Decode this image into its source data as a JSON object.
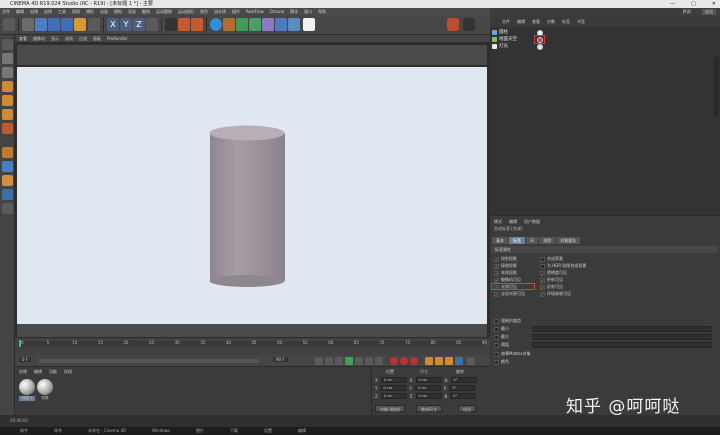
{
  "window": {
    "title": "CINEMA 4D R19.024 Studio (RC - R19) - [未标题 1 *] - 主要",
    "controls": [
      "—",
      "□",
      "✕"
    ]
  },
  "menu": [
    "文件",
    "编辑",
    "创建",
    "选择",
    "工具",
    "网格",
    "捕捉",
    "动画",
    "模拟",
    "渲染",
    "雕刻",
    "运动跟踪",
    "运动图形",
    "角色",
    "流水线",
    "插件",
    "RealFlow",
    "Octane",
    "脚本",
    "窗口",
    "帮助"
  ],
  "right_top": {
    "interface_label": "界面:",
    "interface_value": "启动"
  },
  "viewport": {
    "menu": [
      "查看",
      "摄像机",
      "显示",
      "选项",
      "过滤",
      "面板",
      "ProRender"
    ],
    "label": "透视视图"
  },
  "object_manager": {
    "menu": [
      "文件",
      "编辑",
      "查看",
      "对象",
      "标签",
      "书签"
    ],
    "objects": [
      {
        "name": "圆柱",
        "icon": "cylinder-icon",
        "color": "#6aa2e6"
      },
      {
        "name": "地面天空",
        "icon": "sky-icon",
        "color": "#7fbf6a"
      },
      {
        "name": "灯光",
        "icon": "light-icon",
        "color": "#e8e8e8"
      }
    ]
  },
  "attributes": {
    "menu": [
      "模式",
      "编辑",
      "用户数据"
    ],
    "title": "合成标签 [合成]",
    "tabs": [
      "基本",
      "标签",
      "GI",
      "排除",
      "对象缓存"
    ],
    "active_tab": "标签",
    "section": "标签属性",
    "left_props": [
      {
        "label": "投射投影",
        "checked": true
      },
      {
        "label": "接收投影",
        "checked": true
      },
      {
        "label": "本体投影",
        "checked": true
      },
      {
        "label": "摄像机可见",
        "checked": true,
        "highlight": true
      },
      {
        "label": "光线可见",
        "checked": true
      },
      {
        "label": "全局光照可见",
        "checked": true
      }
    ],
    "right_props": [
      {
        "label": "合成背景",
        "checked": false
      },
      {
        "label": "为 HDR 贴图合成背景",
        "checked": false
      },
      {
        "label": "透明度可见",
        "checked": true
      },
      {
        "label": "折射可见",
        "checked": true
      },
      {
        "label": "反射可见",
        "checked": true
      },
      {
        "label": "环境吸收可见",
        "checked": true
      }
    ],
    "extra": [
      {
        "label": "强制抗锯齿"
      },
      {
        "label": "最小"
      },
      {
        "label": "最大"
      },
      {
        "label": "阈值"
      },
      {
        "label": "遮罩Mattes对象"
      },
      {
        "label": "颜色"
      }
    ]
  },
  "timeline": {
    "ticks": [
      "0",
      "5",
      "10",
      "15",
      "20",
      "25",
      "30",
      "35",
      "40",
      "45",
      "50",
      "55",
      "60",
      "65",
      "70",
      "75",
      "80",
      "85",
      "90"
    ],
    "frame_start": "0 F",
    "frame_end": "90 F",
    "current": "0 F"
  },
  "materials": {
    "menu": [
      "创建",
      "编辑",
      "功能",
      "纹理"
    ],
    "items": [
      "材质.1",
      "材质"
    ]
  },
  "coordinates": {
    "headers": [
      "位置",
      "尺寸",
      "旋转"
    ],
    "rows": [
      {
        "axis": "X",
        "pos": "0 cm",
        "size": "0 cm",
        "rot_label": "H",
        "rot": "0°"
      },
      {
        "axis": "Y",
        "pos": "0 cm",
        "size": "0 cm",
        "rot_label": "P",
        "rot": "0°"
      },
      {
        "axis": "Z",
        "pos": "0 cm",
        "size": "0 cm",
        "rot_label": "B",
        "rot": "0°"
      }
    ],
    "mode": "对象 (相对)",
    "size_mode": "绝对尺寸",
    "apply": "应用"
  },
  "status": "00:00:00",
  "taskbar": [
    "知乎",
    "命令",
    "未命名 - Cinema 4D",
    "Windows",
    "图片",
    "下载",
    "设置",
    "编辑"
  ],
  "watermark": "知乎 @呵呵哒"
}
